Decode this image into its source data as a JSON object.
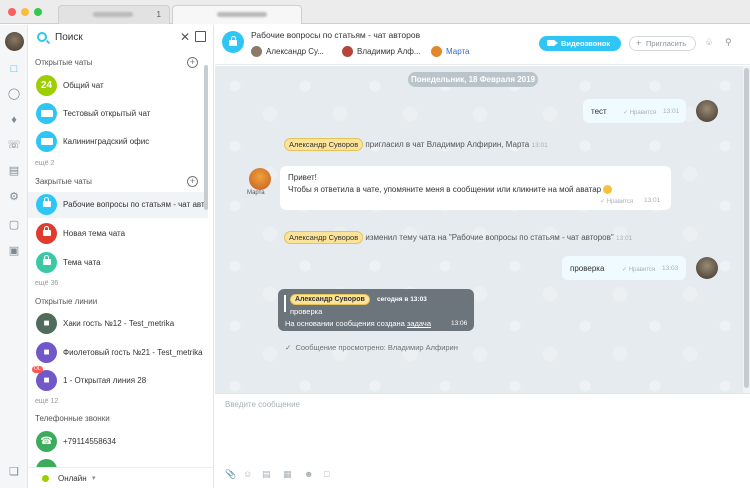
{
  "window": {
    "tabs": [
      {
        "count": "1"
      },
      {}
    ]
  },
  "sidebar": {
    "search_label": "Поиск",
    "sections": {
      "open_chats": "Открытые чаты",
      "closed_chats": "Закрытые чаты",
      "open_lines": "Открытые линии",
      "phone_calls": "Телефонные звонки"
    },
    "open_chats": [
      {
        "name": "Общий чат",
        "avatar_text": "24",
        "color": "#9dcf00"
      },
      {
        "name": "Тестовый открытый чат",
        "color": "#2fc6f6"
      },
      {
        "name": "Калининградский офис",
        "color": "#2fc6f6"
      }
    ],
    "open_more": "ещё 2",
    "closed_chats": [
      {
        "name": "Рабочие вопросы по статьям - чат авторов",
        "color": "#2fc6f6"
      },
      {
        "name": "Новая тема чата",
        "color": "#e03c2d"
      },
      {
        "name": "Тема чата",
        "color": "#3bc8a5"
      }
    ],
    "closed_more": "ещё 36",
    "open_lines": [
      {
        "name": "Хаки гость №12 - Test_metrika",
        "color": "#4f6c5c"
      },
      {
        "name": "Фиолетовый гость №21 - Test_metrika",
        "color": "#7058c8"
      },
      {
        "name": "1 - Открытая линия 28",
        "color": "#7058c8",
        "badge": "OL"
      }
    ],
    "lines_more": "ещё 12",
    "phone_calls": [
      {
        "name": "+79114558634",
        "color": "#3bac5c"
      }
    ],
    "status": "Онлайн"
  },
  "header": {
    "title": "Рабочие вопросы по статьям - чат авторов",
    "members": [
      {
        "name": "Александр Су...",
        "color": "#8a7a66"
      },
      {
        "name": "Владимир Алф...",
        "color": "#b5453a"
      },
      {
        "name": "Марта",
        "color": "#e0892c",
        "accent": "#2f6fc4"
      }
    ],
    "video_button": "Видеозвонок",
    "invite_button": "Пригласить"
  },
  "chat": {
    "date": "Понедельник, 18 Февраля 2019",
    "messages": [
      {
        "text": "тест",
        "status": "Нравится",
        "time": "13:01"
      },
      {
        "sys_name": "Александр Суворов",
        "text": "пригласил в чат Владимир Алфирин, Марта",
        "time": "13:01"
      },
      {
        "author": "Марта",
        "line1": "Привет!",
        "line2": "Чтобы я ответила в чате, упомяните меня в сообщении или кликните на мой аватар",
        "status": "Нравится",
        "time": "13:01"
      },
      {
        "sys_name": "Александр Суворов",
        "text": "изменил тему чата на \"Рабочие вопросы по статьям - чат авторов\"",
        "time": "13:01"
      },
      {
        "text": "проверка",
        "status": "Нравится",
        "time": "13:03"
      }
    ],
    "quote": {
      "author": "Александр Суворов",
      "when": "сегодня в 13:03",
      "text": "проверка",
      "body_prefix": "На основании сообщения создана ",
      "body_link": "задача",
      "time": "13:06"
    },
    "viewed": "Сообщение просмотрено: Владимир Алфирин"
  },
  "input": {
    "placeholder": "Введите сообщение"
  }
}
